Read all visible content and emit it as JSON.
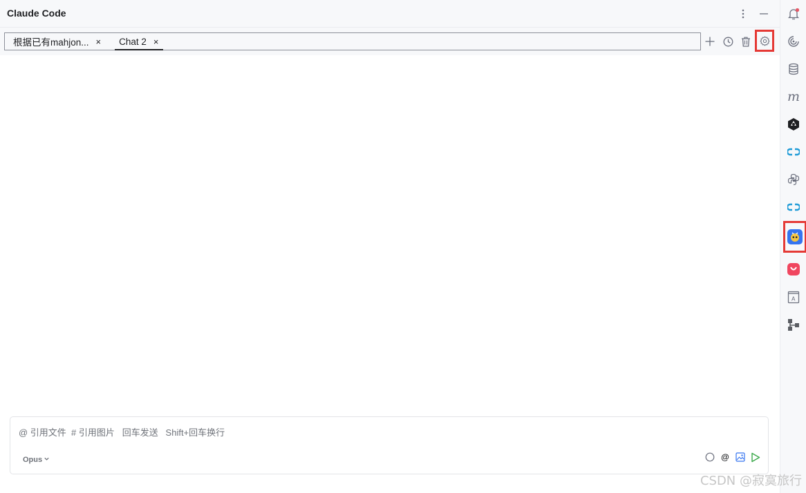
{
  "window": {
    "title": "Claude Code"
  },
  "tabs": [
    {
      "label": "根据已有mahjon...",
      "close": "×"
    },
    {
      "label": "Chat 2",
      "close": "×"
    }
  ],
  "input": {
    "hint": "@ 引用文件  # 引用图片   回车发送   Shift+回车换行",
    "model": "Opus",
    "at_symbol": "@"
  },
  "icons": {
    "title_actions": [
      "more-vertical-icon",
      "minimize-icon"
    ],
    "tab_actions": [
      "new-chat-icon",
      "history-icon",
      "delete-icon",
      "settings-icon"
    ],
    "input_actions": [
      "circle-icon",
      "at-mention-icon",
      "image-icon",
      "send-icon"
    ],
    "side_strip": [
      "notifications-icon",
      "ai-assistant-icon",
      "database-icon",
      "maven-icon",
      "build-tool-icon",
      "link-icon",
      "python-icon",
      "link-icon",
      "claude-code-plugin-icon",
      "app-plugin-icon",
      "translate-icon",
      "structure-icon"
    ]
  },
  "colors": {
    "accent_highlight": "#e53935",
    "send_green": "#3aa84a",
    "plugin_blue": "#3574f0",
    "notify_red": "#e55765"
  },
  "watermark": "CSDN @寂寞旅行"
}
